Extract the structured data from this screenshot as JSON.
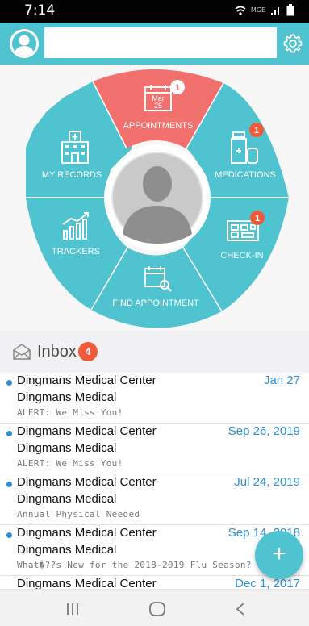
{
  "status_bar": {
    "time": "7:14",
    "network": "MGE"
  },
  "header": {
    "search_placeholder": ""
  },
  "dashboard": {
    "appointments": {
      "label": "APPOINTMENTS",
      "badge": "1",
      "calendar_month": "Mar",
      "calendar_day": "25"
    },
    "medications": {
      "label": "MEDICATIONS",
      "badge": "1"
    },
    "my_records": {
      "label": "MY RECORDS"
    },
    "trackers": {
      "label": "TRACKERS"
    },
    "check_in": {
      "label": "CHECK-IN",
      "badge": "1"
    },
    "find_appointment": {
      "label": "FIND APPOINTMENT"
    }
  },
  "inbox": {
    "title": "Inbox",
    "unread_count": "4",
    "messages": [
      {
        "sender": "Dingmans Medical Center",
        "date": "Jan 27",
        "facility": "Dingmans Medical",
        "subject": "ALERT: We Miss You!"
      },
      {
        "sender": "Dingmans Medical Center",
        "date": "Sep 26, 2019",
        "facility": "Dingmans Medical",
        "subject": "ALERT: We Miss You!"
      },
      {
        "sender": "Dingmans Medical Center",
        "date": "Jul 24, 2019",
        "facility": "Dingmans Medical",
        "subject": "Annual Physical Needed"
      },
      {
        "sender": "Dingmans Medical Center",
        "date": "Sep 14, 2018",
        "facility": "Dingmans Medical",
        "subject": "What�??s New for the 2018-2019 Flu Season?"
      },
      {
        "sender": "Dingmans Medical Center",
        "date": "Dec 1, 2017",
        "facility": "",
        "subject": ""
      }
    ]
  },
  "fab": {
    "label": "+"
  },
  "colors": {
    "teal": "#4fc3cf",
    "appointments_red": "#f2706d",
    "badge_red": "#f05a3a",
    "link_blue": "#2b8fd6"
  }
}
